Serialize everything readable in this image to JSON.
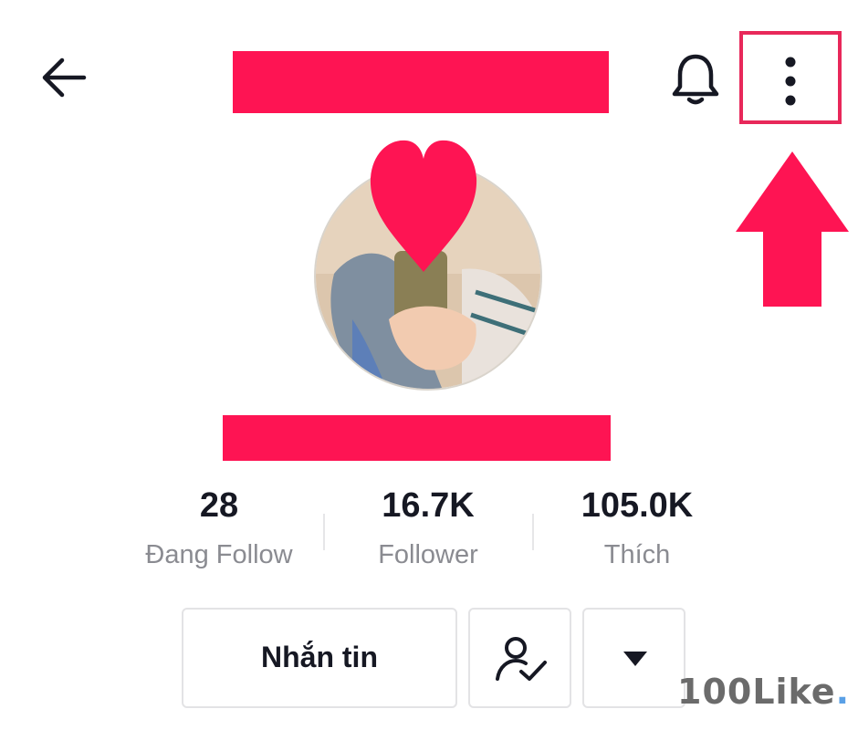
{
  "header": {
    "back_icon": "arrow-left-icon",
    "notification_icon": "bell-icon",
    "more_icon": "more-vertical-icon"
  },
  "annotation": {
    "highlight_color": "#e8285a",
    "arrow_color": "#fe1453"
  },
  "redaction_color": "#fe1453",
  "stats": [
    {
      "value": "28",
      "label": "Đang Follow"
    },
    {
      "value": "16.7K",
      "label": "Follower"
    },
    {
      "value": "105.0K",
      "label": "Thích"
    }
  ],
  "actions": {
    "message_label": "Nhắn tin",
    "friend_icon": "user-check-icon",
    "dropdown_icon": "caret-down-icon"
  },
  "watermark": {
    "text": "100Like",
    "dot": "."
  }
}
